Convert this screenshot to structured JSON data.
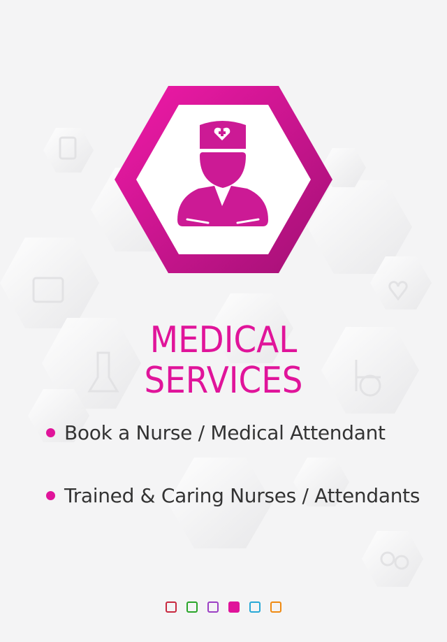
{
  "slide": {
    "title_line1": "MEDICAL",
    "title_line2": "SERVICES",
    "icon": "nurse-icon",
    "features": [
      {
        "text": "Book a Nurse / Medical Attendant"
      },
      {
        "text": "Trained & Caring Nurses / Attendants"
      }
    ]
  },
  "colors": {
    "accent": "#e0149a",
    "text": "#333333",
    "background": "#f4f4f5"
  },
  "pager": {
    "current_index": 3,
    "dots": [
      {
        "color": "#c8283f"
      },
      {
        "color": "#2aa52a"
      },
      {
        "color": "#9b3fc4"
      },
      {
        "color": "#e0149a"
      },
      {
        "color": "#27a8d6"
      },
      {
        "color": "#ef8a12"
      }
    ]
  }
}
